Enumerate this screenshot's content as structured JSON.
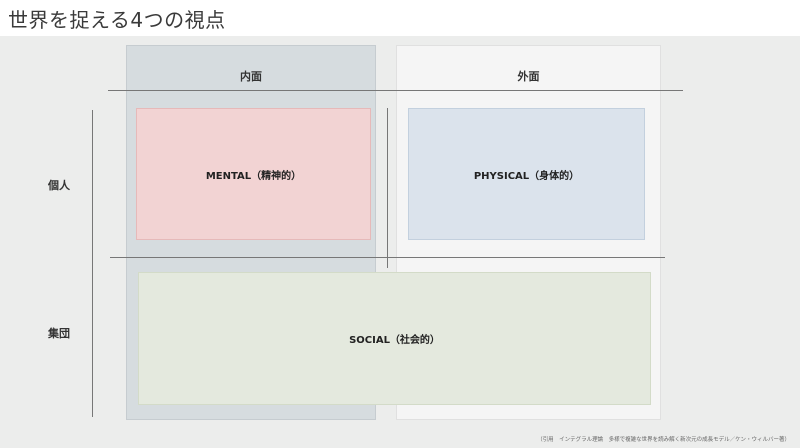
{
  "title": "世界を捉える4つの視点",
  "columns": {
    "inner": "内面",
    "outer": "外面"
  },
  "rows": {
    "individual": "個人",
    "collective": "集団"
  },
  "quadrants": {
    "mental": "MENTAL（精神的）",
    "physical": "PHYSICAL（身体的）",
    "social": "SOCIAL（社会的）"
  },
  "footnote": "（引用　インテグラル理論　多様で複雑な世界を読み解く新次元の成長モデル／ケン・ウィルバー著）",
  "colors": {
    "inner_column": "#d6dcdf",
    "outer_column": "#f5f5f5",
    "mental": "#f2d3d3",
    "physical": "#dbe3ec",
    "social": "#e4e9de"
  }
}
